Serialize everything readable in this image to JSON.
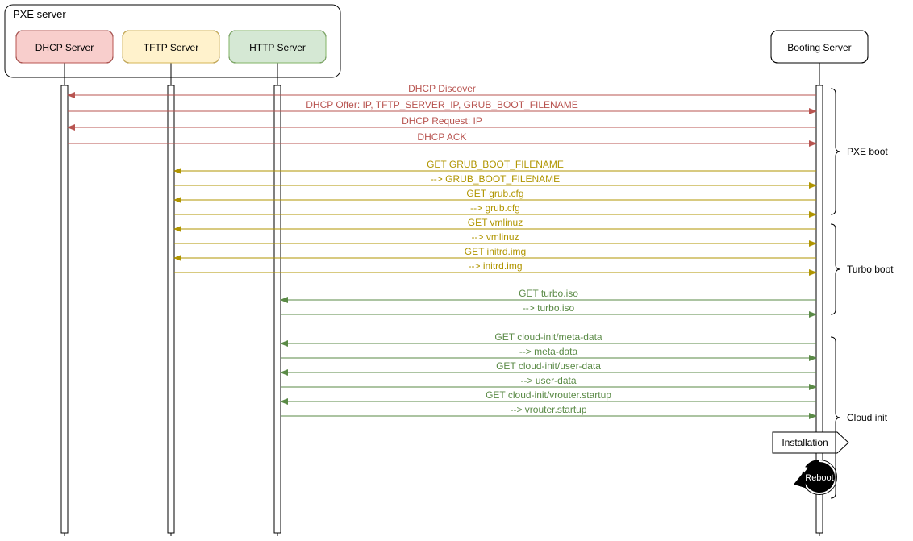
{
  "group": {
    "title": "PXE server"
  },
  "participants": {
    "dhcp": {
      "label": "DHCP Server",
      "fill": "#f8cecc",
      "stroke": "#b85450"
    },
    "tftp": {
      "label": "TFTP Server",
      "fill": "#fff2cc",
      "stroke": "#d6b656"
    },
    "http": {
      "label": "HTTP Server",
      "fill": "#d5e8d4",
      "stroke": "#82b366"
    },
    "boot": {
      "label": "Booting Server",
      "fill": "#ffffff",
      "stroke": "#000000"
    }
  },
  "phases": {
    "pxe": "PXE boot",
    "turbo": "Turbo boot",
    "cloud": "Cloud init"
  },
  "note": {
    "label": "Installation"
  },
  "reboot": {
    "label": "Reboot"
  },
  "messages": {
    "m1": "DHCP Discover",
    "m2": "DHCP Offer: IP, TFTP_SERVER_IP, GRUB_BOOT_FILENAME",
    "m3": "DHCP Request: IP",
    "m4": "DHCP ACK",
    "m5": "GET GRUB_BOOT_FILENAME",
    "m6": "--> GRUB_BOOT_FILENAME",
    "m7": "GET grub.cfg",
    "m8": "--> grub.cfg",
    "m9": "GET vmlinuz",
    "m10": "--> vmlinuz",
    "m11": "GET initrd.img",
    "m12": "--> initrd.img",
    "m13": "GET turbo.iso",
    "m14": "--> turbo.iso",
    "m15": "GET cloud-init/meta-data",
    "m16": "--> meta-data",
    "m17": "GET cloud-init/user-data",
    "m18": "--> user-data",
    "m19": "GET cloud-init/vrouter.startup",
    "m20": "--> vrouter.startup"
  },
  "colors": {
    "red": "#b85450",
    "yellow": "#b09500",
    "green": "#5a8a46"
  },
  "chart_data": {
    "type": "sequence-diagram",
    "participants": [
      "DHCP Server",
      "TFTP Server",
      "HTTP Server",
      "Booting Server"
    ],
    "group": {
      "name": "PXE server",
      "members": [
        "DHCP Server",
        "TFTP Server",
        "HTTP Server"
      ]
    },
    "phases": [
      {
        "name": "PXE boot",
        "messages": [
          "m1",
          "m2",
          "m3",
          "m4",
          "m5",
          "m6",
          "m7",
          "m8"
        ]
      },
      {
        "name": "Turbo boot",
        "messages": [
          "m9",
          "m10",
          "m11",
          "m12",
          "m13",
          "m14"
        ]
      },
      {
        "name": "Cloud init",
        "messages": [
          "m15",
          "m16",
          "m17",
          "m18",
          "m19",
          "m20",
          "note",
          "reboot"
        ]
      }
    ],
    "messages": [
      {
        "id": "m1",
        "from": "Booting Server",
        "to": "DHCP Server",
        "text": "DHCP Discover",
        "color": "red"
      },
      {
        "id": "m2",
        "from": "DHCP Server",
        "to": "Booting Server",
        "text": "DHCP Offer: IP, TFTP_SERVER_IP, GRUB_BOOT_FILENAME",
        "color": "red"
      },
      {
        "id": "m3",
        "from": "Booting Server",
        "to": "DHCP Server",
        "text": "DHCP Request: IP",
        "color": "red"
      },
      {
        "id": "m4",
        "from": "DHCP Server",
        "to": "Booting Server",
        "text": "DHCP ACK",
        "color": "red"
      },
      {
        "id": "m5",
        "from": "Booting Server",
        "to": "TFTP Server",
        "text": "GET GRUB_BOOT_FILENAME",
        "color": "yellow"
      },
      {
        "id": "m6",
        "from": "TFTP Server",
        "to": "Booting Server",
        "text": "--> GRUB_BOOT_FILENAME",
        "color": "yellow"
      },
      {
        "id": "m7",
        "from": "Booting Server",
        "to": "TFTP Server",
        "text": "GET grub.cfg",
        "color": "yellow"
      },
      {
        "id": "m8",
        "from": "TFTP Server",
        "to": "Booting Server",
        "text": "--> grub.cfg",
        "color": "yellow"
      },
      {
        "id": "m9",
        "from": "Booting Server",
        "to": "TFTP Server",
        "text": "GET vmlinuz",
        "color": "yellow"
      },
      {
        "id": "m10",
        "from": "TFTP Server",
        "to": "Booting Server",
        "text": "--> vmlinuz",
        "color": "yellow"
      },
      {
        "id": "m11",
        "from": "Booting Server",
        "to": "TFTP Server",
        "text": "GET initrd.img",
        "color": "yellow"
      },
      {
        "id": "m12",
        "from": "TFTP Server",
        "to": "Booting Server",
        "text": "--> initrd.img",
        "color": "yellow"
      },
      {
        "id": "m13",
        "from": "Booting Server",
        "to": "HTTP Server",
        "text": "GET turbo.iso",
        "color": "green"
      },
      {
        "id": "m14",
        "from": "HTTP Server",
        "to": "Booting Server",
        "text": "--> turbo.iso",
        "color": "green"
      },
      {
        "id": "m15",
        "from": "Booting Server",
        "to": "HTTP Server",
        "text": "GET cloud-init/meta-data",
        "color": "green"
      },
      {
        "id": "m16",
        "from": "HTTP Server",
        "to": "Booting Server",
        "text": "--> meta-data",
        "color": "green"
      },
      {
        "id": "m17",
        "from": "Booting Server",
        "to": "HTTP Server",
        "text": "GET cloud-init/user-data",
        "color": "green"
      },
      {
        "id": "m18",
        "from": "HTTP Server",
        "to": "Booting Server",
        "text": "--> user-data",
        "color": "green"
      },
      {
        "id": "m19",
        "from": "Booting Server",
        "to": "HTTP Server",
        "text": "GET cloud-init/vrouter.startup",
        "color": "green"
      },
      {
        "id": "m20",
        "from": "HTTP Server",
        "to": "Booting Server",
        "text": "--> vrouter.startup",
        "color": "green"
      }
    ],
    "notes": [
      {
        "id": "note",
        "on": "Booting Server",
        "text": "Installation"
      },
      {
        "id": "reboot",
        "on": "Booting Server",
        "text": "Reboot",
        "kind": "self-loop"
      }
    ]
  }
}
